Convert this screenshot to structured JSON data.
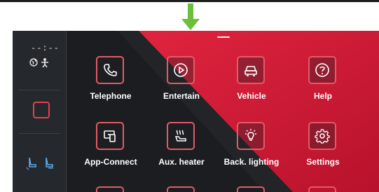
{
  "statusbar": {
    "clock": "--:--",
    "icons": [
      "globe-icon",
      "person-icon"
    ]
  },
  "sidebar": {
    "home_icon": "home-square-icon",
    "seat_icons": [
      "seat-heat-driver-icon",
      "seat-heat-passenger-icon"
    ]
  },
  "colors": {
    "accent": "#e45a66",
    "screen_bg": "#1b1d20",
    "diagonal_red": "#d31c3a",
    "indicator_arrow": "#6cbf3a"
  },
  "menu": {
    "rows": [
      [
        {
          "label": "Telephone",
          "icon": "phone-icon"
        },
        {
          "label": "Entertain",
          "icon": "play-icon"
        },
        {
          "label": "Vehicle",
          "icon": "car-icon"
        },
        {
          "label": "Help",
          "icon": "help-icon"
        }
      ],
      [
        {
          "label": "App-Connect",
          "icon": "app-connect-icon"
        },
        {
          "label": "Aux. heater",
          "icon": "aux-heater-icon"
        },
        {
          "label": "Back. lighting",
          "icon": "backlight-icon"
        },
        {
          "label": "Settings",
          "icon": "gear-icon"
        }
      ]
    ]
  }
}
